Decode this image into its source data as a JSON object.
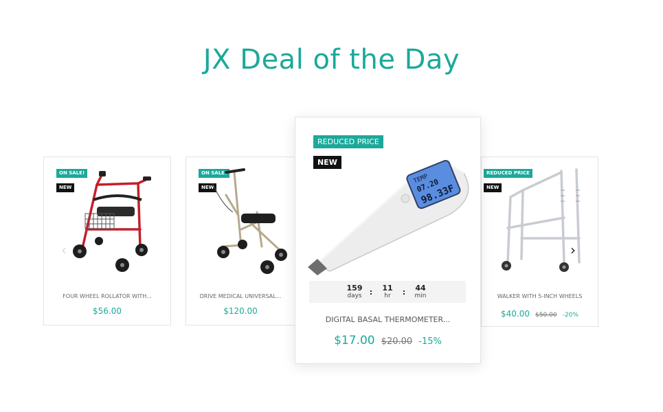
{
  "page": {
    "title": "JX Deal of the Day"
  },
  "countdown": {
    "days": "159",
    "days_label": "days",
    "hours": "11",
    "hours_label": "hr",
    "minutes": "44",
    "minutes_label": "min",
    "separator": ":"
  },
  "carousel": {
    "prev_icon": "chevron-left-icon",
    "next_icon": "chevron-right-icon",
    "prev_glyph": "‹",
    "next_glyph": "›"
  },
  "products": [
    {
      "name": "FOUR WHEEL ROLLATOR WITH...",
      "price": "$56.00",
      "badges": [
        "ON SALE!",
        "NEW"
      ],
      "image": "red-rollator-walker"
    },
    {
      "name": "DRIVE MEDICAL UNIVERSAL...",
      "price": "$120.00",
      "badges": [
        "ON SALE!",
        "NEW"
      ],
      "image": "knee-walker"
    },
    {
      "name": "DIGITAL BASAL THERMOMETER...",
      "price": "$17.00",
      "old_price": "$20.00",
      "discount": "-15%",
      "badges": [
        "REDUCED PRICE",
        "NEW"
      ],
      "image": "digital-thermometer",
      "screen_text": [
        "TEMP",
        "07.20",
        "98.33F"
      ]
    },
    {
      "name": "WALKER WITH 5-INCH WHEELS",
      "price": "$40.00",
      "old_price": "$50.00",
      "discount": "-20%",
      "badges": [
        "REDUCED PRICE",
        "NEW"
      ],
      "image": "folding-walker"
    }
  ],
  "colors": {
    "accent": "#1aa99a",
    "badge_dark": "#111111",
    "rollator_frame": "#c41f2a",
    "knee_walker_frame": "#b6a98c",
    "walker_frame": "#c8ccd2",
    "thermo_screen": "#5a8de0"
  }
}
